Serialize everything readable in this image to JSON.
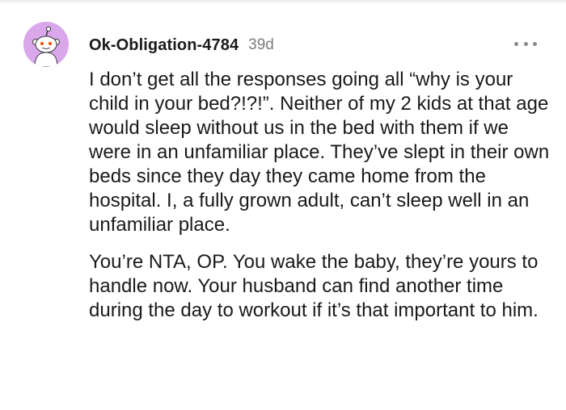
{
  "comment": {
    "username": "Ok-Obligation-4784",
    "age": "39d",
    "avatar_icon": "reddit-snoo-avatar-icon",
    "more_icon": "more-options-icon",
    "paragraphs": [
      "I don’t get all the responses going all “why is your child in your bed?!?!”. Neither of my 2 kids at that age would sleep without us in the bed with them if we were in an unfamiliar place. They’ve slept in their own beds since they day they came home from the hospital. I, a fully grown adult, can’t sleep well in an unfamiliar place.",
      "You’re NTA, OP. You wake the baby, they’re yours to handle now. Your husband can find another time during the day to workout if it’s that important to him."
    ]
  },
  "colors": {
    "avatar_bg": "#d9a7ea",
    "username": "#1a1a1b",
    "meta": "#7c7c7c",
    "icon": "#878a8c"
  }
}
